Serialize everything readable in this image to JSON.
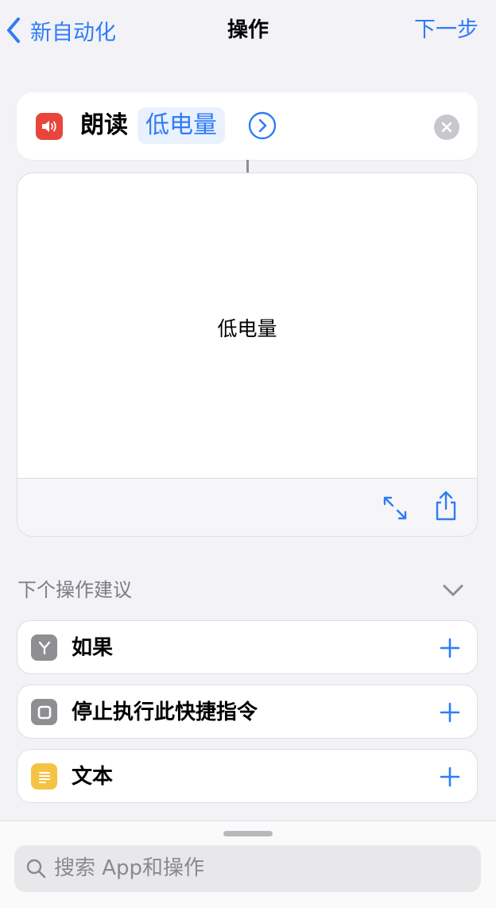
{
  "nav": {
    "back_label": "新自动化",
    "title": "操作",
    "next_label": "下一步"
  },
  "action": {
    "name": "朗读",
    "parameter": "低电量"
  },
  "preview": {
    "text": "低电量"
  },
  "suggestions": {
    "header": "下个操作建议",
    "items": [
      {
        "label": "如果",
        "icon": "branch-icon",
        "icon_color": "#8e8e93"
      },
      {
        "label": "停止执行此快捷指令",
        "icon": "stop-icon",
        "icon_color": "#8e8e93"
      },
      {
        "label": "文本",
        "icon": "text-icon",
        "icon_color": "#f5c344"
      }
    ]
  },
  "search": {
    "placeholder": "搜索 App和操作"
  },
  "colors": {
    "accent": "#2f7cf6",
    "speak_icon": "#e8453c",
    "background": "#f2f2f7"
  }
}
